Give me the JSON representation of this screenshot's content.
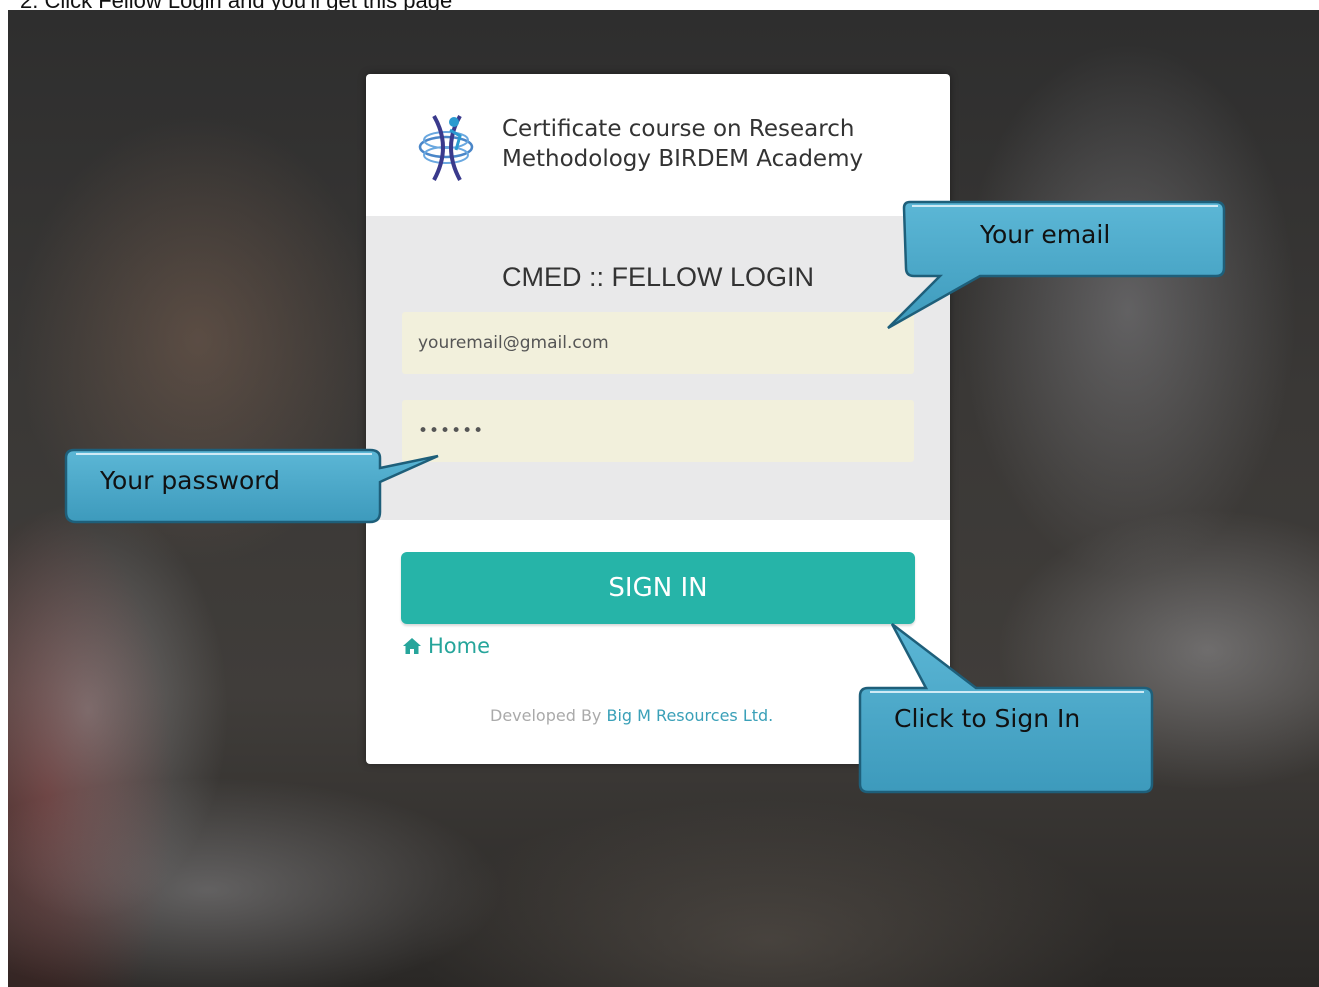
{
  "caption": "2. Click Fellow Login and you'll get this page",
  "card": {
    "course_title_line1": "Certificate course on Research",
    "course_title_line2": "Methodology BIRDEM Academy",
    "login_heading": "CMED :: FELLOW LOGIN",
    "email_value": "youremail@gmail.com",
    "password_value": "••••••",
    "signin_label": "SIGN IN",
    "home_label": "Home",
    "home_icon": "home-icon",
    "footer_prefix": "Developed By ",
    "footer_company": "Big M Resources Ltd."
  },
  "callouts": {
    "email": "Your email",
    "password": "Your password",
    "signin": "Click to Sign In"
  },
  "colors": {
    "accent": "#26b4a8",
    "callout_fill": "#4aa8c8",
    "field_bg": "#f2f0dc"
  }
}
